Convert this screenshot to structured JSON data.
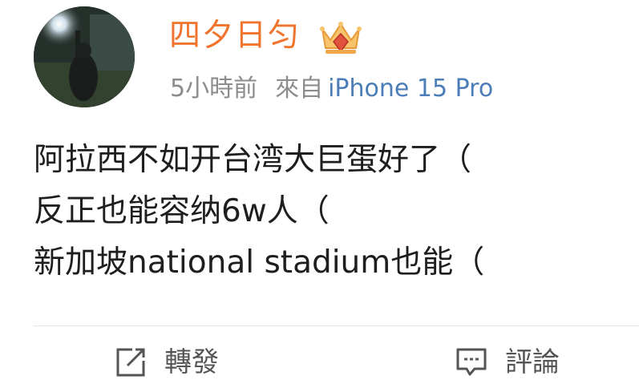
{
  "post": {
    "author": {
      "name": "四夕日匀",
      "avatar_icon": "user-avatar-photo",
      "badge_icon": "vip-crown-icon"
    },
    "meta": {
      "time": "5小時前",
      "source_prefix": "來自",
      "device": "iPhone 15 Pro"
    },
    "content_lines": [
      "阿拉西不如开台湾大巨蛋好了（",
      "反正也能容纳6w人（",
      "新加坡national stadium也能（"
    ],
    "actions": {
      "repost_label": "轉發",
      "repost_icon": "share-edit-icon",
      "comment_label": "評論",
      "comment_icon": "comment-bubble-icon"
    }
  },
  "colors": {
    "username": "#f0742d",
    "device_link": "#4b7eb8",
    "meta_text": "#8c8c8c",
    "body_text": "#1e1e1e"
  }
}
